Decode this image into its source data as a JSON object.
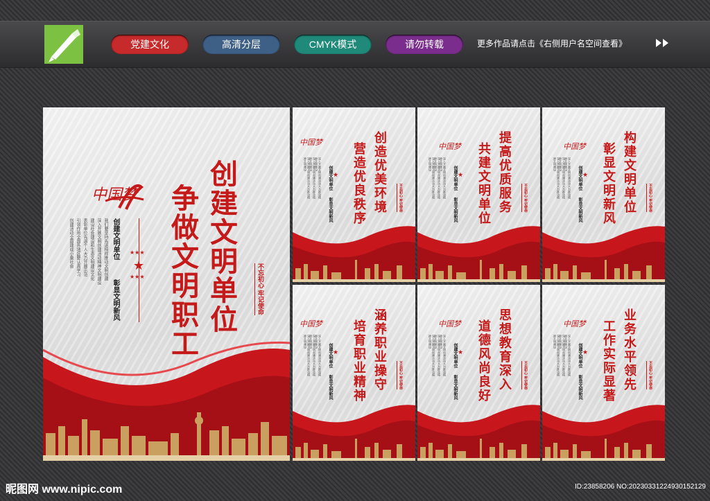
{
  "header": {
    "logo_icon": "pen-nib-icon",
    "pills": [
      {
        "label": "党建文化",
        "color": "#c72a2a"
      },
      {
        "label": "高清分层",
        "color": "#3e5f86"
      },
      {
        "label": "CMYK模式",
        "color": "#1f8a7a"
      },
      {
        "label": "请勿转载",
        "color": "#7a2d8c"
      }
    ],
    "more_text": "更多作品请点击《右侧用户名空间查看》",
    "more_icon": "double-chevron-right-icon"
  },
  "main_poster": {
    "title_line1": "创建文明单位",
    "title_line2": "争做文明职工",
    "sub_line1": "创建文明单位",
    "sub_line2": "彰显文明新风",
    "stamp": "不忘初心 牢记使命",
    "brush": "中国梦",
    "body_cols": [
      "创建活动全面建成小康社会",
      "引领作用全国各地区要认真学习",
      "表彰单位先进个人大力开展示范",
      "建设社会建设和生态文明建设文化",
      "深入开展文明创建活动精神文明建设",
      "我们要坚持先进榜样推动文明创建"
    ]
  },
  "small_posters": [
    {
      "line1": "创造优美环境",
      "line2": "营造优良秩序",
      "sub1": "创建文明单位",
      "sub2": "彰显文明新风"
    },
    {
      "line1": "提高优质服务",
      "line2": "共建文明单位",
      "sub1": "创建文明单位",
      "sub2": "彰显文明新风"
    },
    {
      "line1": "构建文明单位",
      "line2": "彰显文明新风",
      "sub1": "创建文明单位",
      "sub2": "彰显文明新风"
    },
    {
      "line1": "涵养职业操守",
      "line2": "培育职业精神",
      "sub1": "创建文明单位",
      "sub2": "彰显文明新风"
    },
    {
      "line1": "思想教育深入",
      "line2": "道德风尚良好",
      "sub1": "创建文明单位",
      "sub2": "彰显文明新风"
    },
    {
      "line1": "业务水平领先",
      "line2": "工作实际显著",
      "sub1": "创建文明单位",
      "sub2": "彰显文明新风"
    }
  ],
  "small_stamp": "不忘初心 牢记使命",
  "small_body": "深入开展文明创建活动大力推动精神文明建设",
  "footer": {
    "left": "昵图网 www.nipic.com",
    "right": "ID:23858206 NO:20230331224930152129"
  }
}
